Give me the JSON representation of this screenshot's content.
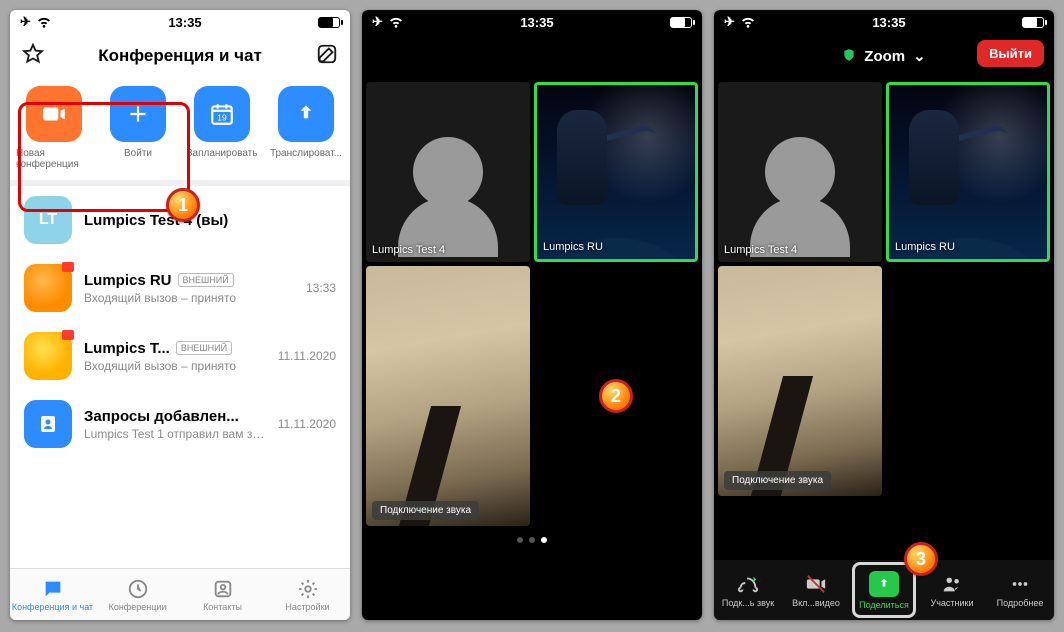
{
  "status": {
    "time": "13:35",
    "battery_pct": 70
  },
  "screen1": {
    "title": "Конференция и чат",
    "actions": {
      "new": "Новая конференция",
      "join": "Войти",
      "schedule": "Запланировать",
      "broadcast": "Транслироват...",
      "schedule_day": "19"
    },
    "chats": [
      {
        "avatar_text": "LT",
        "name": "Lumpics  Test 4 (вы)",
        "badge": "",
        "time": "",
        "sub": ""
      },
      {
        "name": "Lumpics RU",
        "badge": "ВНЕШНИЙ",
        "time": "13:33",
        "sub": "Входящий вызов – принято"
      },
      {
        "name": "Lumpics T...",
        "badge": "ВНЕШНИЙ",
        "time": "11.11.2020",
        "sub": "Входящий вызов – принято"
      },
      {
        "name": "Запросы добавлен...",
        "badge": "",
        "time": "11.11.2020",
        "sub": "Lumpics Test 1 отправил вам запр..."
      }
    ],
    "tabs": {
      "t1": "Конференция и чат",
      "t2": "Конференции",
      "t3": "Контакты",
      "t4": "Настройки"
    }
  },
  "meeting": {
    "brand": "Zoom",
    "leave": "Выйти",
    "tiles": {
      "p1": "Lumpics Test 4",
      "p2": "Lumpics RU",
      "audio": "Подключение звука"
    },
    "toolbar": {
      "audio": "Подк...ь звук",
      "video": "Вкл...видео",
      "share": "Поделиться",
      "participants": "Участники",
      "more": "Подробнее"
    }
  },
  "markers": {
    "m1": "1",
    "m2": "2",
    "m3": "3"
  }
}
